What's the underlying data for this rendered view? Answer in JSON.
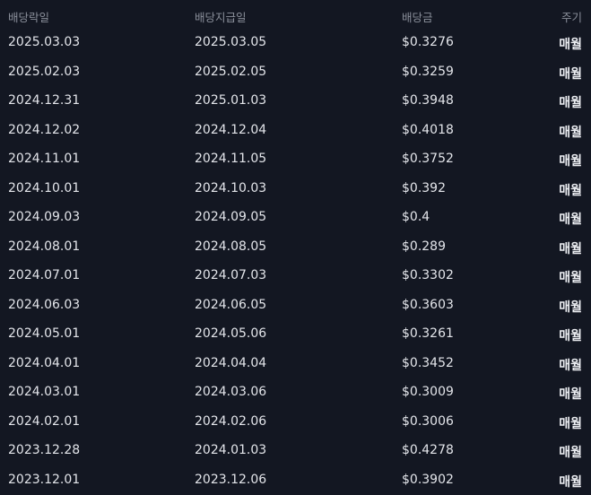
{
  "headers": {
    "ex_date": "배당락일",
    "pay_date": "배당지급일",
    "amount": "배당금",
    "frequency": "주기"
  },
  "rows": [
    {
      "ex_date": "2025.03.03",
      "pay_date": "2025.03.05",
      "amount": "$0.3276",
      "frequency": "매월"
    },
    {
      "ex_date": "2025.02.03",
      "pay_date": "2025.02.05",
      "amount": "$0.3259",
      "frequency": "매월"
    },
    {
      "ex_date": "2024.12.31",
      "pay_date": "2025.01.03",
      "amount": "$0.3948",
      "frequency": "매월"
    },
    {
      "ex_date": "2024.12.02",
      "pay_date": "2024.12.04",
      "amount": "$0.4018",
      "frequency": "매월"
    },
    {
      "ex_date": "2024.11.01",
      "pay_date": "2024.11.05",
      "amount": "$0.3752",
      "frequency": "매월"
    },
    {
      "ex_date": "2024.10.01",
      "pay_date": "2024.10.03",
      "amount": "$0.392",
      "frequency": "매월"
    },
    {
      "ex_date": "2024.09.03",
      "pay_date": "2024.09.05",
      "amount": "$0.4",
      "frequency": "매월"
    },
    {
      "ex_date": "2024.08.01",
      "pay_date": "2024.08.05",
      "amount": "$0.289",
      "frequency": "매월"
    },
    {
      "ex_date": "2024.07.01",
      "pay_date": "2024.07.03",
      "amount": "$0.3302",
      "frequency": "매월"
    },
    {
      "ex_date": "2024.06.03",
      "pay_date": "2024.06.05",
      "amount": "$0.3603",
      "frequency": "매월"
    },
    {
      "ex_date": "2024.05.01",
      "pay_date": "2024.05.06",
      "amount": "$0.3261",
      "frequency": "매월"
    },
    {
      "ex_date": "2024.04.01",
      "pay_date": "2024.04.04",
      "amount": "$0.3452",
      "frequency": "매월"
    },
    {
      "ex_date": "2024.03.01",
      "pay_date": "2024.03.06",
      "amount": "$0.3009",
      "frequency": "매월"
    },
    {
      "ex_date": "2024.02.01",
      "pay_date": "2024.02.06",
      "amount": "$0.3006",
      "frequency": "매월"
    },
    {
      "ex_date": "2023.12.28",
      "pay_date": "2024.01.03",
      "amount": "$0.4278",
      "frequency": "매월"
    },
    {
      "ex_date": "2023.12.01",
      "pay_date": "2023.12.06",
      "amount": "$0.3902",
      "frequency": "매월"
    }
  ]
}
